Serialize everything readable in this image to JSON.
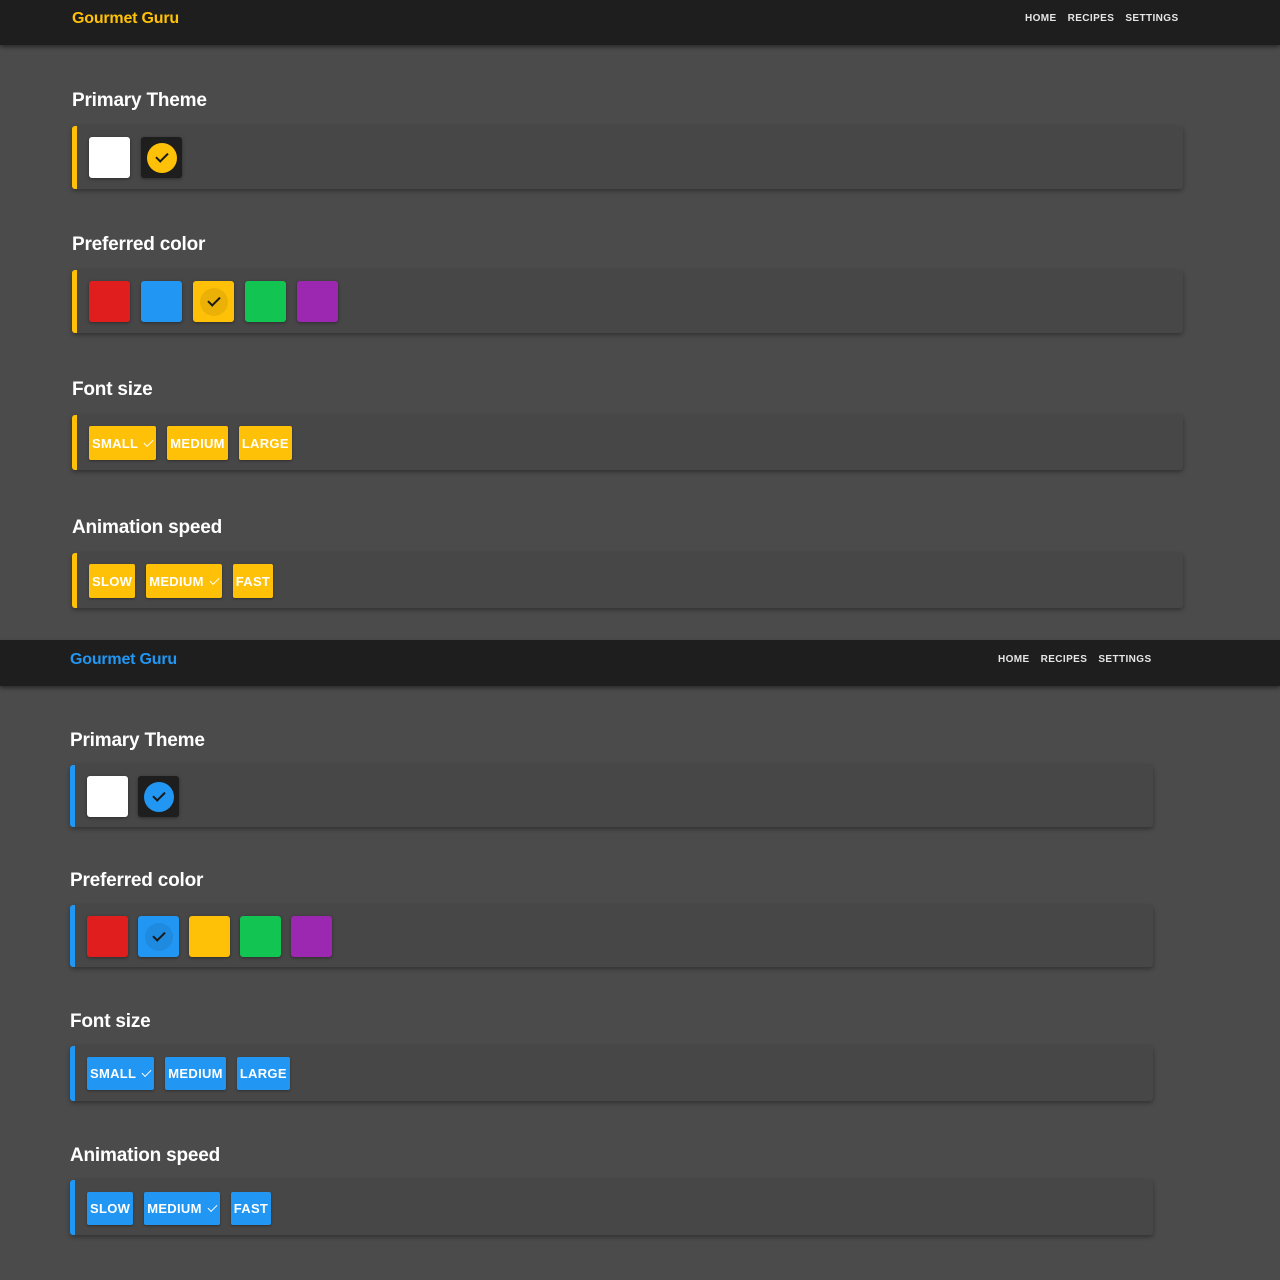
{
  "panels": [
    {
      "accent": "#ffc107",
      "logo": {
        "part_a": "Gour",
        "part_b": "met Guru",
        "color_a": "#ffc107",
        "color_b": "#ffc107"
      },
      "nav": [
        "HOME",
        "RECIPES",
        "SETTINGS"
      ],
      "sections": {
        "theme": {
          "title": "Primary Theme",
          "options": [
            {
              "color": "#ffffff",
              "selected": false
            },
            {
              "color": "#1e1e1e",
              "selected": true
            }
          ]
        },
        "color": {
          "title": "Preferred color",
          "options": [
            {
              "color": "#e01e1e",
              "selected": false
            },
            {
              "color": "#2196f3",
              "selected": false
            },
            {
              "color": "#ffc107",
              "selected": true
            },
            {
              "color": "#12c452",
              "selected": false
            },
            {
              "color": "#9c27b0",
              "selected": false
            }
          ]
        },
        "font": {
          "title": "Font size",
          "options": [
            {
              "label": "SMALL",
              "selected": true
            },
            {
              "label": "MEDIUM",
              "selected": false
            },
            {
              "label": "LARGE",
              "selected": false
            }
          ]
        },
        "speed": {
          "title": "Animation speed",
          "options": [
            {
              "label": "SLOW",
              "selected": false
            },
            {
              "label": "MEDIUM",
              "selected": true
            },
            {
              "label": "FAST",
              "selected": false
            }
          ]
        }
      }
    },
    {
      "accent": "#2196f3",
      "logo": {
        "part_a": "Gour",
        "part_b": "met Guru",
        "color_a": "#2196f3",
        "color_b": "#2196f3"
      },
      "nav": [
        "HOME",
        "RECIPES",
        "SETTINGS"
      ],
      "sections": {
        "theme": {
          "title": "Primary Theme",
          "options": [
            {
              "color": "#ffffff",
              "selected": false
            },
            {
              "color": "#1e1e1e",
              "selected": true
            }
          ]
        },
        "color": {
          "title": "Preferred color",
          "options": [
            {
              "color": "#e01e1e",
              "selected": false
            },
            {
              "color": "#2196f3",
              "selected": true
            },
            {
              "color": "#ffc107",
              "selected": false
            },
            {
              "color": "#12c452",
              "selected": false
            },
            {
              "color": "#9c27b0",
              "selected": false
            }
          ]
        },
        "font": {
          "title": "Font size",
          "options": [
            {
              "label": "SMALL",
              "selected": true
            },
            {
              "label": "MEDIUM",
              "selected": false
            },
            {
              "label": "LARGE",
              "selected": false
            }
          ]
        },
        "speed": {
          "title": "Animation speed",
          "options": [
            {
              "label": "SLOW",
              "selected": false
            },
            {
              "label": "MEDIUM",
              "selected": true
            },
            {
              "label": "FAST",
              "selected": false
            }
          ]
        }
      }
    }
  ]
}
